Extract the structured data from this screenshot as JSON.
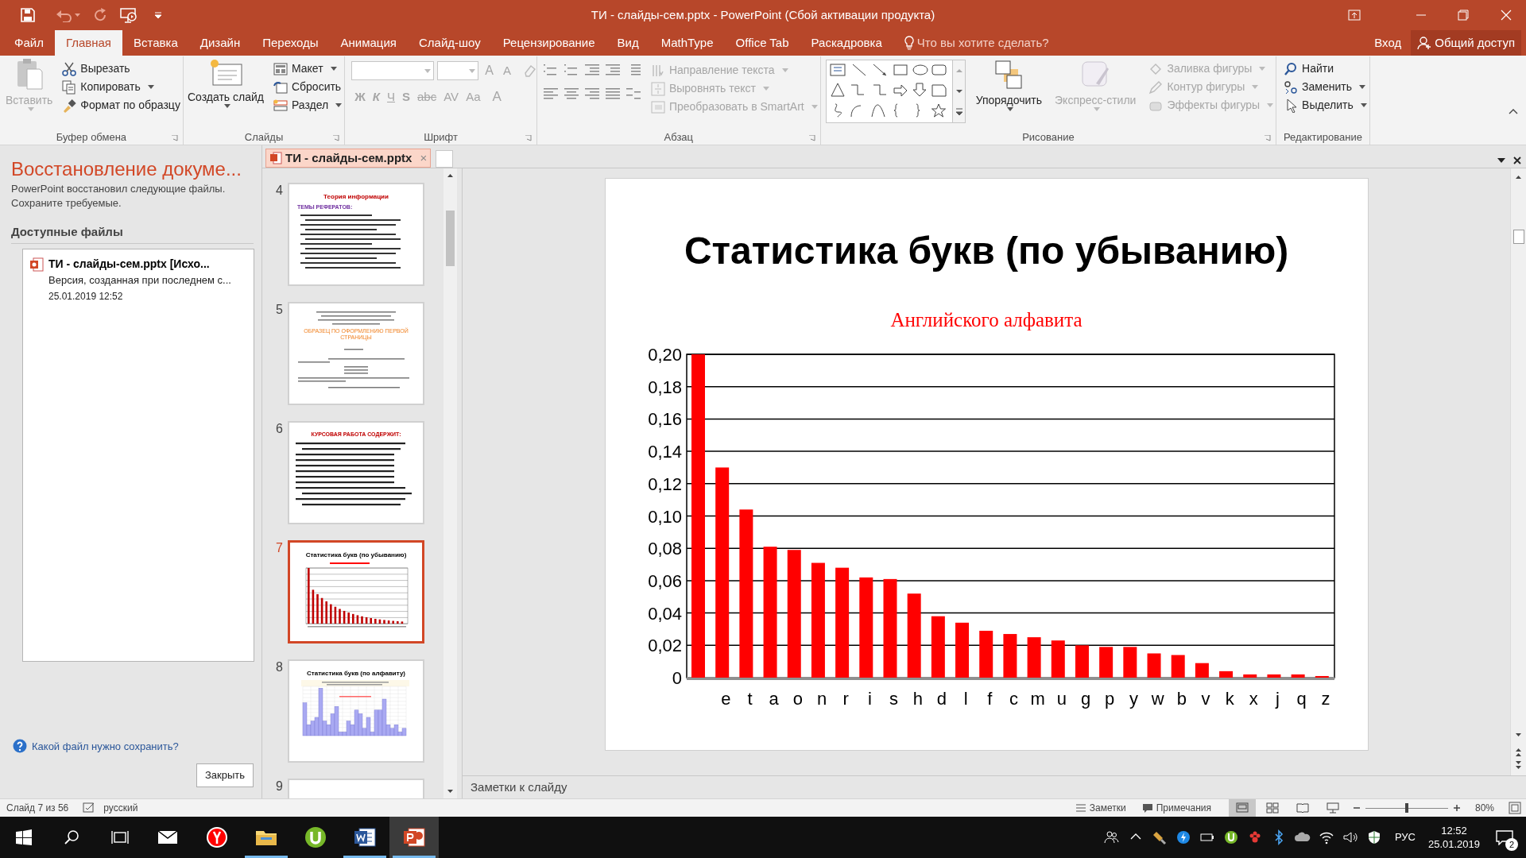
{
  "window": {
    "title": "ТИ - слайды-сем.pptx - PowerPoint (Сбой активации продукта)"
  },
  "menu_tabs": [
    {
      "label": "Файл",
      "selected": false
    },
    {
      "label": "Главная",
      "selected": true
    },
    {
      "label": "Вставка",
      "selected": false
    },
    {
      "label": "Дизайн",
      "selected": false
    },
    {
      "label": "Переходы",
      "selected": false
    },
    {
      "label": "Анимация",
      "selected": false
    },
    {
      "label": "Слайд-шоу",
      "selected": false
    },
    {
      "label": "Рецензирование",
      "selected": false
    },
    {
      "label": "Вид",
      "selected": false
    },
    {
      "label": "MathType",
      "selected": false
    },
    {
      "label": "Office Tab",
      "selected": false
    },
    {
      "label": "Раскадровка",
      "selected": false
    }
  ],
  "tell_me": {
    "placeholder": "Что вы хотите сделать?"
  },
  "sign_in": "Вход",
  "share": "Общий доступ",
  "ribbon": {
    "groups": [
      {
        "kind": "clipboard",
        "label": "Буфер обмена",
        "buttons": [
          {
            "label": "Вставить",
            "disabled": true
          },
          {
            "label": "Вырезать",
            "disabled": false
          },
          {
            "label": "Копировать",
            "disabled": false
          },
          {
            "label": "Формат по образцу",
            "disabled": false
          }
        ]
      },
      {
        "kind": "slides",
        "label": "Слайды",
        "buttons": [
          {
            "label": "Создать слайд",
            "disabled": false
          },
          {
            "label": "Макет",
            "disabled": false
          },
          {
            "label": "Сбросить",
            "disabled": false
          },
          {
            "label": "Раздел",
            "disabled": false
          }
        ]
      },
      {
        "kind": "font",
        "label": "Шрифт",
        "buttons": [
          {
            "label": "A",
            "disabled": true
          },
          {
            "label": "A",
            "disabled": true
          },
          {
            "label": "Ж",
            "disabled": true
          },
          {
            "label": "К",
            "disabled": true
          },
          {
            "label": "Ч",
            "disabled": true
          },
          {
            "label": "S",
            "disabled": true
          },
          {
            "label": "abc",
            "disabled": true
          },
          {
            "label": "AV",
            "disabled": true
          },
          {
            "label": "Aa",
            "disabled": true
          },
          {
            "label": "A",
            "disabled": true
          }
        ]
      },
      {
        "kind": "paragraph",
        "label": "Абзац",
        "buttons": [
          {
            "label": "Направление текста",
            "disabled": true
          },
          {
            "label": "Выровнять текст",
            "disabled": true
          },
          {
            "label": "Преобразовать в SmartArt",
            "disabled": true
          }
        ]
      },
      {
        "kind": "drawing",
        "label": "Рисование",
        "buttons": [
          {
            "label": "Упорядочить",
            "disabled": false
          },
          {
            "label": "Экспресс-стили",
            "disabled": true
          },
          {
            "label": "Заливка фигуры",
            "disabled": true
          },
          {
            "label": "Контур фигуры",
            "disabled": true
          },
          {
            "label": "Эффекты фигуры",
            "disabled": true
          }
        ]
      },
      {
        "kind": "editing",
        "label": "Редактирование",
        "buttons": [
          {
            "label": "Найти",
            "disabled": false
          },
          {
            "label": "Заменить",
            "disabled": false
          },
          {
            "label": "Выделить",
            "disabled": false
          }
        ]
      }
    ]
  },
  "recovery": {
    "title": "Восстановление докуме...",
    "description_lines": [
      "PowerPoint восстановил следующие файлы.",
      "Сохраните требуемые."
    ],
    "files_heading": "Доступные файлы",
    "files": [
      {
        "name": "ТИ - слайды-сем.pptx  [Исхо...",
        "description": "Версия, созданная при последнем с...",
        "date": "25.01.2019 12:52"
      }
    ],
    "help_link": "Какой файл нужно сохранить?",
    "close_button": "Закрыть"
  },
  "document_tab": {
    "label": "ТИ - слайды-сем.pptx",
    "close": "×"
  },
  "slides": [
    {
      "number": "4",
      "selected": false,
      "kind": "list",
      "title": "Теория информации",
      "heading": "ТЕМЫ РЕФЕРАТОВ:"
    },
    {
      "number": "5",
      "selected": false,
      "kind": "form",
      "heading": "ОБРАЗЕЦ ПО ОФОРМЛЕНИЮ ПЕРВОЙ СТРАНИЦЫ"
    },
    {
      "number": "6",
      "selected": false,
      "kind": "bullets",
      "title": "КУРСОВАЯ РАБОТА СОДЕРЖИТ:"
    },
    {
      "number": "7",
      "selected": true,
      "kind": "chart",
      "title": "Статистика букв (по убыванию)"
    },
    {
      "number": "8",
      "selected": false,
      "kind": "histogram",
      "title": "Статистика букв (по алфавиту)"
    },
    {
      "number": "9",
      "selected": false,
      "kind": "blank"
    }
  ],
  "slide": {
    "title": "Статистика букв (по убыванию)",
    "chart_data": {
      "type": "bar",
      "title": "Английского алфавита",
      "grid": true,
      "categories": [
        null,
        "e",
        "t",
        "a",
        "o",
        "n",
        "r",
        "i",
        "s",
        "h",
        "d",
        "l",
        "f",
        "c",
        "m",
        "u",
        "g",
        "p",
        "y",
        "w",
        "b",
        "v",
        "k",
        "x",
        "j",
        "q",
        "z"
      ],
      "series": [
        {
          "color": "#ff0000",
          "values": [
            0.2,
            0.13,
            0.104,
            0.081,
            0.079,
            0.071,
            0.068,
            0.062,
            0.061,
            0.052,
            0.038,
            0.034,
            0.029,
            0.027,
            0.025,
            0.023,
            0.02,
            0.019,
            0.019,
            0.015,
            0.014,
            0.009,
            0.004,
            0.002,
            0.002,
            0.002,
            0.001
          ]
        }
      ],
      "ylim": [
        0,
        0.2
      ],
      "yticks": [
        {
          "value": 0,
          "label": "0"
        },
        {
          "value": 0.02,
          "label": "0,02"
        },
        {
          "value": 0.04,
          "label": "0,04"
        },
        {
          "value": 0.06,
          "label": "0,06"
        },
        {
          "value": 0.08,
          "label": "0,08"
        },
        {
          "value": 0.1,
          "label": "0,10"
        },
        {
          "value": 0.12,
          "label": "0,12"
        },
        {
          "value": 0.14,
          "label": "0,14"
        },
        {
          "value": 0.16,
          "label": "0,16"
        },
        {
          "value": 0.18,
          "label": "0,18"
        },
        {
          "value": 0.2,
          "label": "0,20"
        }
      ]
    }
  },
  "notes": {
    "placeholder": "Заметки к слайду"
  },
  "status_bar": {
    "slide": "Слайд 7 из 56",
    "language": "русский",
    "notes": "Заметки",
    "comments": "Примечания",
    "zoom": "80%",
    "zoom_slider": {
      "level": 0.5
    },
    "views": [
      {
        "kind": "normal",
        "selected": true
      },
      {
        "kind": "sorter",
        "selected": false
      },
      {
        "kind": "reading",
        "selected": false
      },
      {
        "kind": "show",
        "selected": false
      }
    ]
  },
  "taskbar": {
    "apps": [
      {
        "kind": "mail",
        "selected": false,
        "running": false
      },
      {
        "kind": "browser",
        "selected": false,
        "running": false
      },
      {
        "kind": "folder",
        "selected": false,
        "running": true
      },
      {
        "kind": "torrent",
        "selected": false,
        "running": false
      },
      {
        "kind": "word",
        "selected": false,
        "running": true
      },
      {
        "kind": "powerpoint",
        "selected": true,
        "running": true
      }
    ],
    "language": "РУС",
    "time": "12:52",
    "date": "25.01.2019",
    "notifications": "2"
  }
}
